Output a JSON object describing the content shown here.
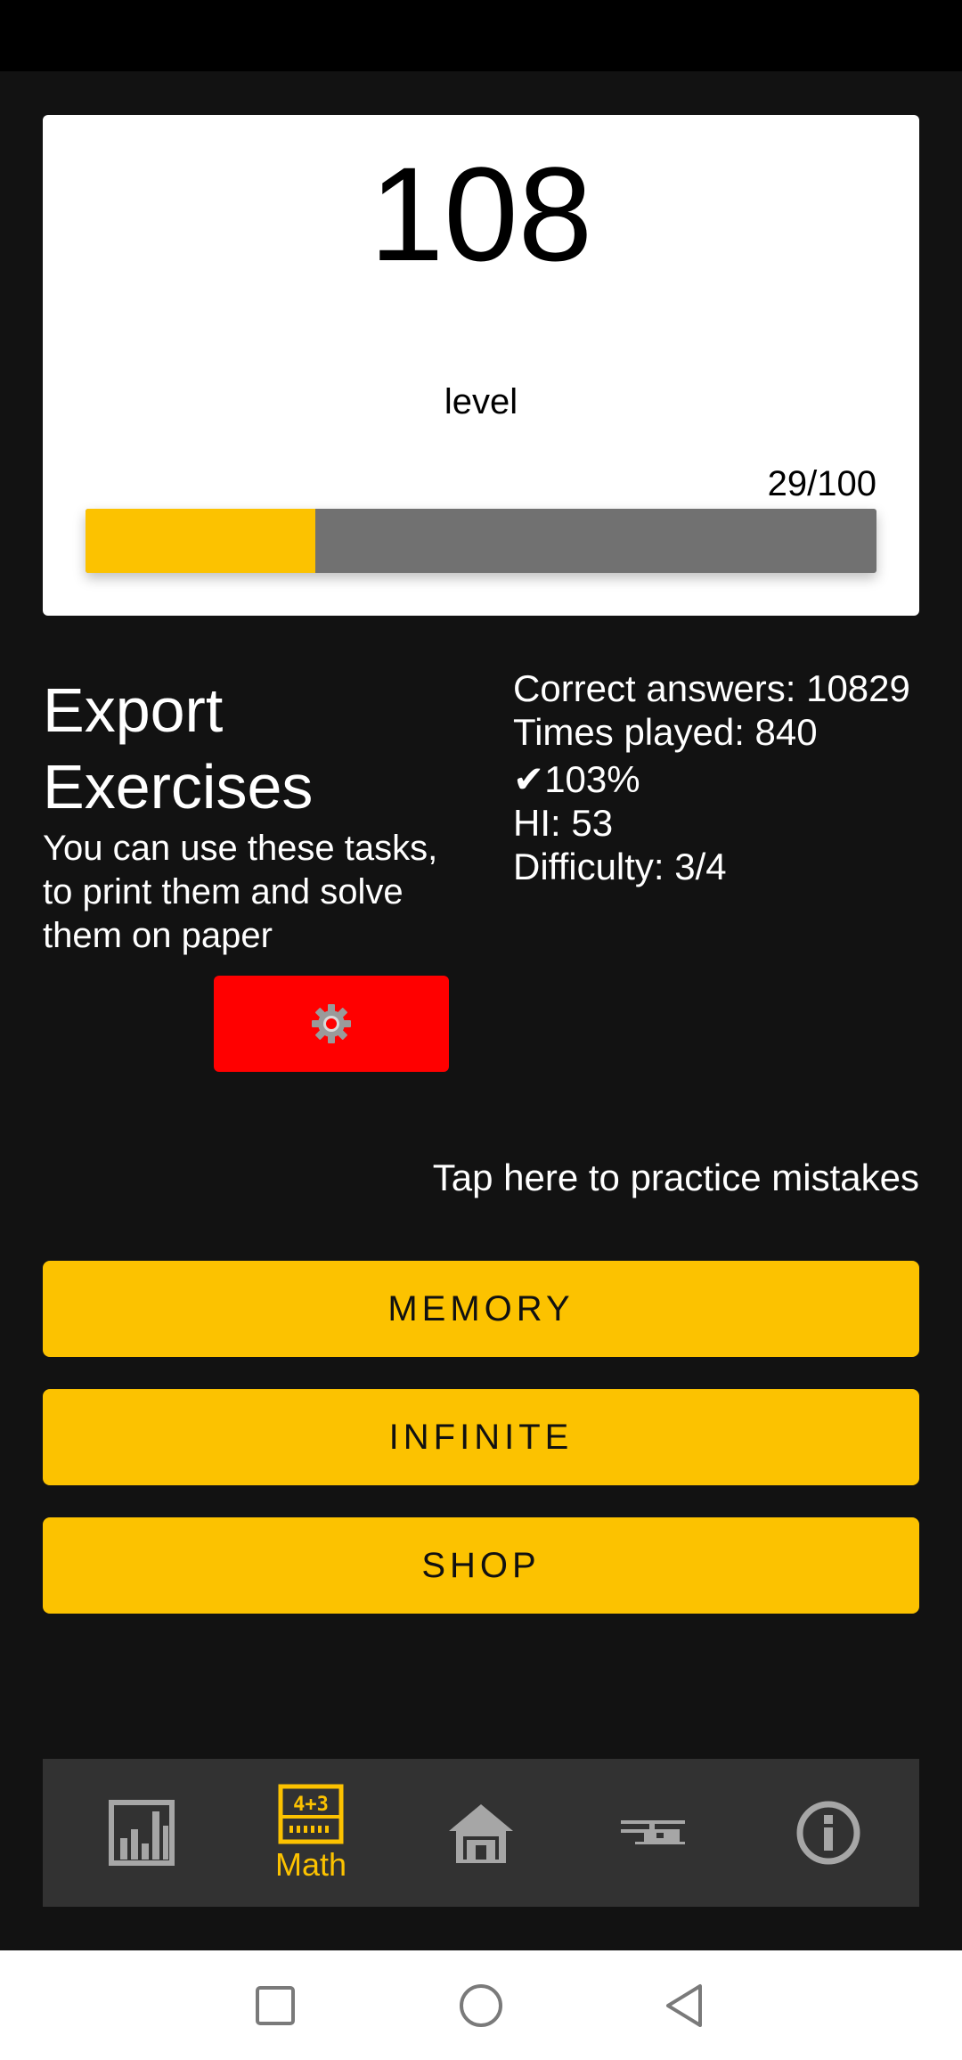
{
  "level_card": {
    "level_number": "108",
    "level_label": "level",
    "progress_text": "29/100",
    "progress_fraction": 0.29
  },
  "export": {
    "title_line1": "Export",
    "title_line2": "Exercises",
    "description": "You can use these tasks, to print them and solve them on paper",
    "button_icon": "gear-icon"
  },
  "stats": {
    "correct_answers": "Correct answers: 10829",
    "times_played": "Times played: 840",
    "accuracy": "✔103%",
    "hi": "HI: 53",
    "difficulty": "Difficulty: 3/4"
  },
  "mistakes_link": "Tap here to practice mistakes",
  "buttons": {
    "memory": "MEMORY",
    "infinite": "INFINITE",
    "shop": "SHOP"
  },
  "bottom_nav": {
    "items": [
      {
        "icon": "bar-chart-icon",
        "label": ""
      },
      {
        "icon": "calculator-icon",
        "label": "Math",
        "active": true
      },
      {
        "icon": "home-icon",
        "label": ""
      },
      {
        "icon": "helicopter-icon",
        "label": ""
      },
      {
        "icon": "info-icon",
        "label": ""
      }
    ]
  },
  "colors": {
    "background": "#121212",
    "accent": "#fcc200",
    "export_button": "#ff0000",
    "progress_track": "#717171",
    "nav_background": "#323232",
    "nav_icon": "#a6a6a6"
  }
}
